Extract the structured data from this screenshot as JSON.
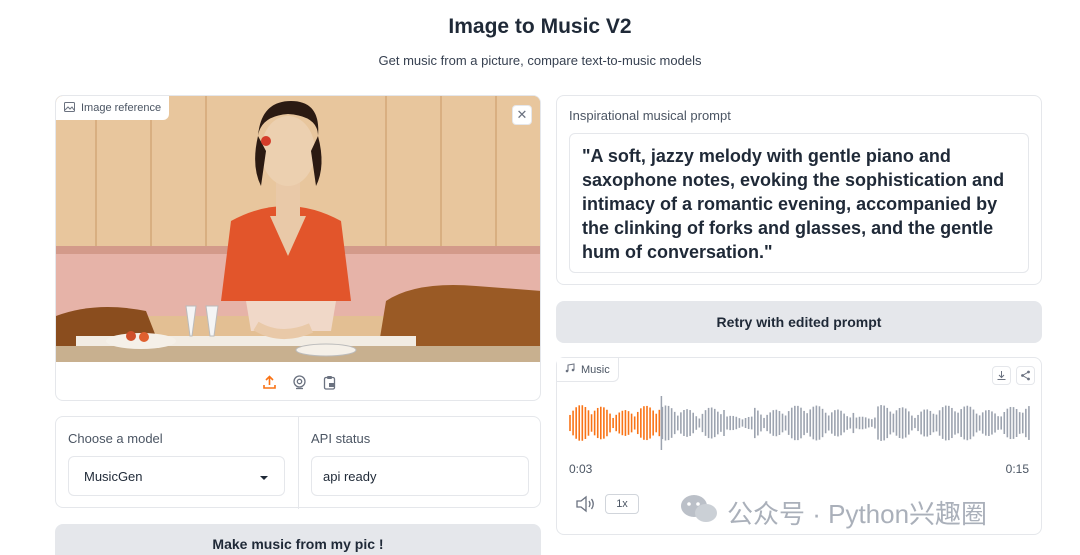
{
  "header": {
    "title": "Image to Music V2",
    "subtitle": "Get music from a picture, compare text-to-music models"
  },
  "image_input": {
    "label": "Image reference",
    "close_icon": "close-icon",
    "tools": [
      "upload-icon",
      "webcam-icon",
      "clipboard-icon"
    ]
  },
  "model": {
    "label": "Choose a model",
    "selected": "MusicGen"
  },
  "api": {
    "label": "API status",
    "value": "api ready"
  },
  "make_button": "Make music from my pic !",
  "prompt": {
    "label": "Inspirational musical prompt",
    "text": "\"A soft, jazzy melody with gentle piano and saxophone notes, evoking the sophistication and intimacy of a romantic evening, accompanied by the clinking of forks and glasses, and the gentle hum of conversation.\""
  },
  "retry_button": "Retry with edited prompt",
  "audio": {
    "label": "Music",
    "current_time": "0:03",
    "duration": "0:15",
    "progress": 0.2,
    "speed": "1x",
    "played_color": "#f97316",
    "unplayed_color": "#9ca3af"
  },
  "watermark": {
    "text": "公众号 · Python兴趣圈"
  }
}
